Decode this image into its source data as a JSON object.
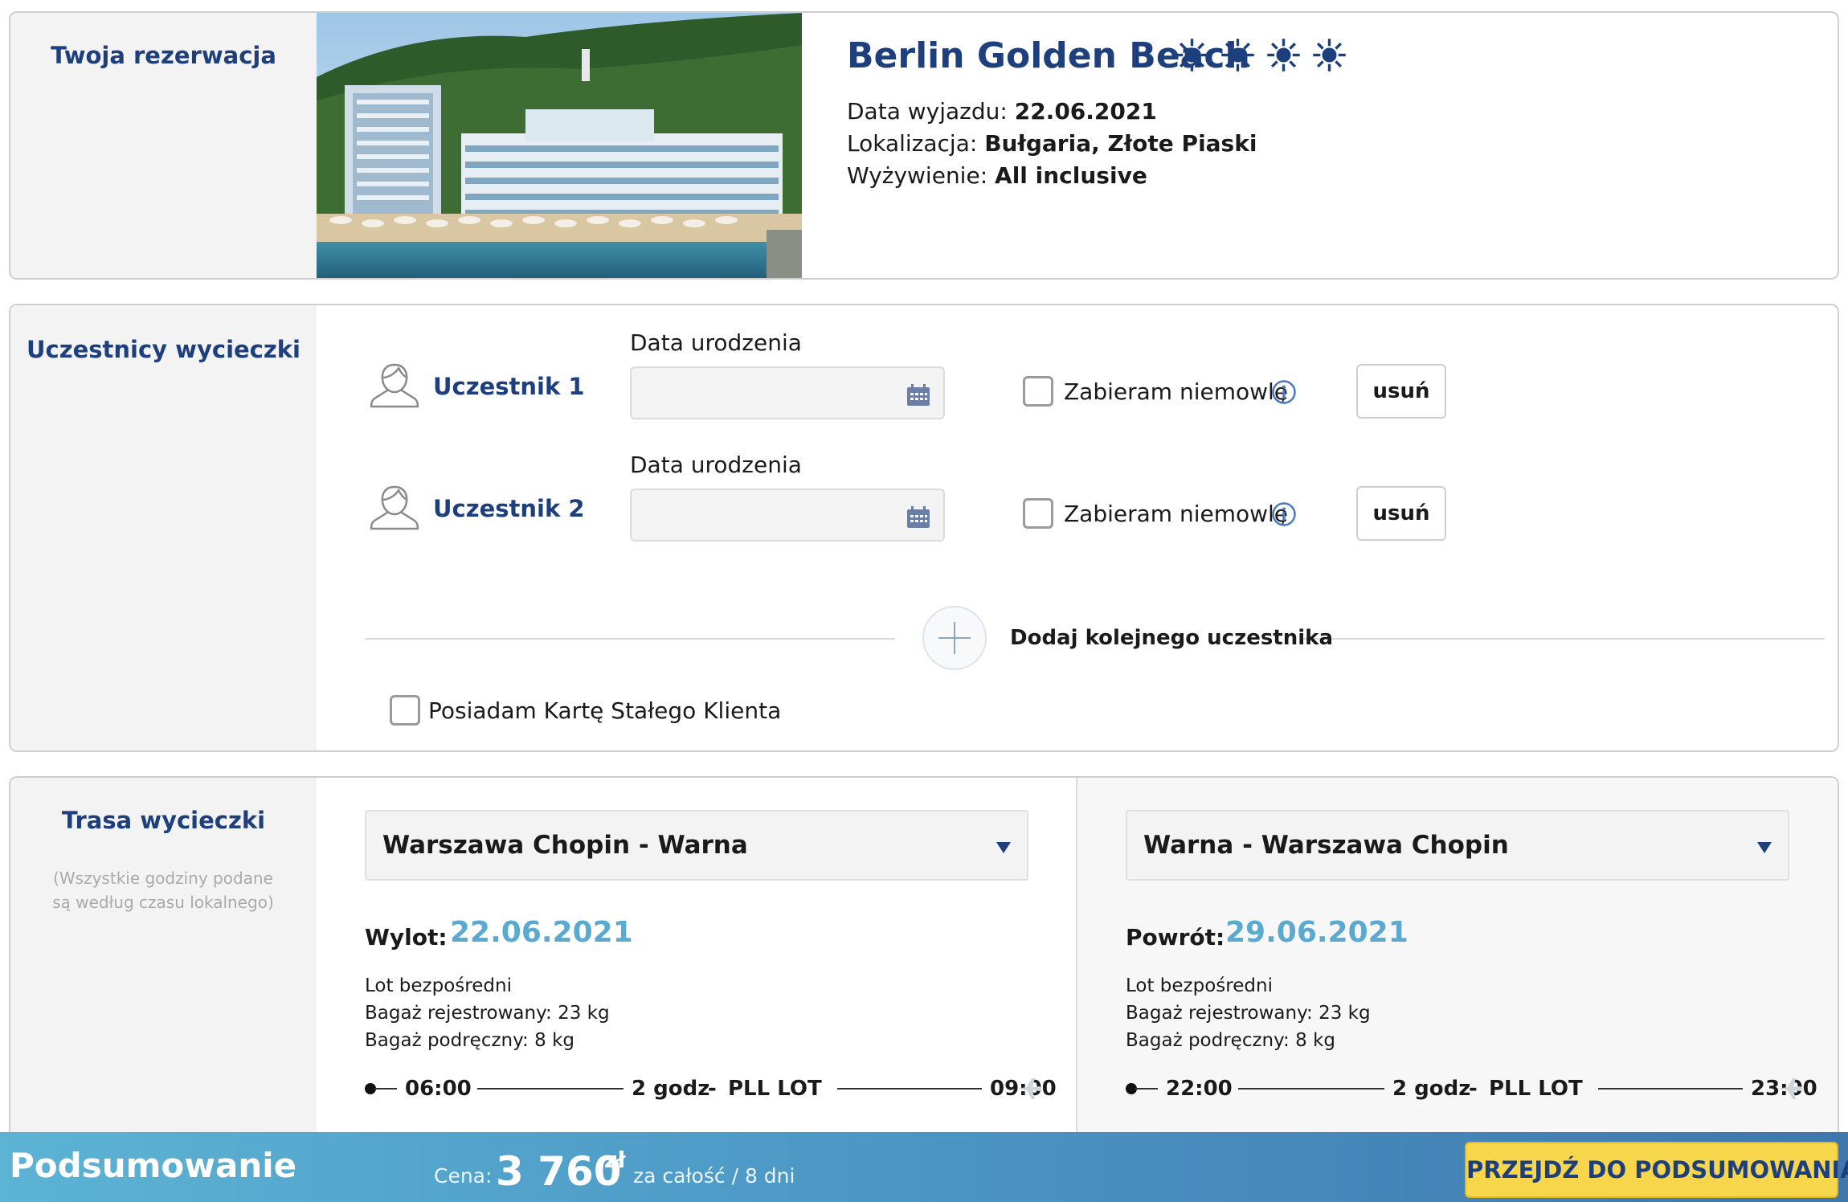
{
  "booking": {
    "section_title": "Twoja rezerwacja",
    "hotel_name": "Berlin Golden Beach",
    "rating_icon": "sun-icon",
    "rating": 4,
    "departure_label": "Data wyjazdu: ",
    "departure_value": "22.06.2021",
    "location_label": "Lokalizacja: ",
    "location_value": "Bułgaria, Złote Piaski",
    "board_label": "Wyżywienie: ",
    "board_value": "All inclusive"
  },
  "participants": {
    "section_title": "Uczestnicy wycieczki",
    "items": [
      {
        "name": "Uczestnik 1",
        "dob_label": "Data urodzenia",
        "dob_value": "",
        "infant_label": "Zabieram niemowlę",
        "infant_checked": false,
        "remove_label": "usuń"
      },
      {
        "name": "Uczestnik 2",
        "dob_label": "Data urodzenia",
        "dob_value": "",
        "infant_label": "Zabieram niemowlę",
        "infant_checked": false,
        "remove_label": "usuń"
      }
    ],
    "add_label": "Dodaj kolejnego uczestnika",
    "loyalty_label": "Posiadam Kartę Stałego Klienta",
    "loyalty_checked": false
  },
  "route": {
    "section_title": "Trasa wycieczki",
    "note": "(Wszystkie godziny podane są według czasu lokalnego)",
    "outbound": {
      "select_value": "Warszawa Chopin - Warna",
      "date_label": "Wylot:",
      "date": "22.06.2021",
      "type": "Lot bezpośredni",
      "baggage_checked": "Bagaż rejestrowany: 23 kg",
      "baggage_hand": "Bagaż podręczny: 8 kg",
      "dep_time": "06:00",
      "duration": "2 godz",
      "airline": "PLL LOT",
      "arr_time": "09:00"
    },
    "inbound": {
      "select_value": "Warna - Warszawa Chopin",
      "date_label": "Powrót:",
      "date": "29.06.2021",
      "type": "Lot bezpośredni",
      "baggage_checked": "Bagaż rejestrowany: 23 kg",
      "baggage_hand": "Bagaż podręczny: 8 kg",
      "dep_time": "22:00",
      "duration": "2 godz",
      "airline": "PLL LOT",
      "arr_time": "23:00"
    },
    "separator": "-"
  },
  "summary": {
    "title": "Podsumowanie",
    "price_label": "Cena:",
    "price_value": "3 760",
    "currency": "zł",
    "price_note": "za całość / 8 dni",
    "cta_label": "PRZEJDŹ DO PODSUMOWANIA"
  },
  "colors": {
    "brand_blue": "#1e3f7d",
    "date_blue": "#5aa9d0",
    "cta_yellow": "#f7d64c"
  }
}
